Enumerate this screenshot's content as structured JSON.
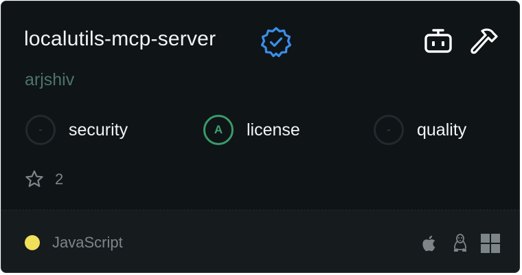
{
  "card": {
    "title": "localutils-mcp-server",
    "owner": "arjshiv",
    "verified_icon": "verified-badge-icon",
    "actions": [
      {
        "icon": "robot-icon"
      },
      {
        "icon": "hammer-icon"
      }
    ]
  },
  "metrics": [
    {
      "grade": "-",
      "label": "security"
    },
    {
      "grade": "A",
      "label": "license"
    },
    {
      "grade": "-",
      "label": "quality"
    }
  ],
  "stars": {
    "icon": "star-icon",
    "count": "2"
  },
  "language": {
    "name": "JavaScript",
    "color": "#f1e05a"
  },
  "platforms": [
    "apple-icon",
    "linux-icon",
    "windows-icon"
  ],
  "colors": {
    "accent_blue": "#3b8eea",
    "grade_green": "#3da56f",
    "owner_green": "#4d7469"
  }
}
